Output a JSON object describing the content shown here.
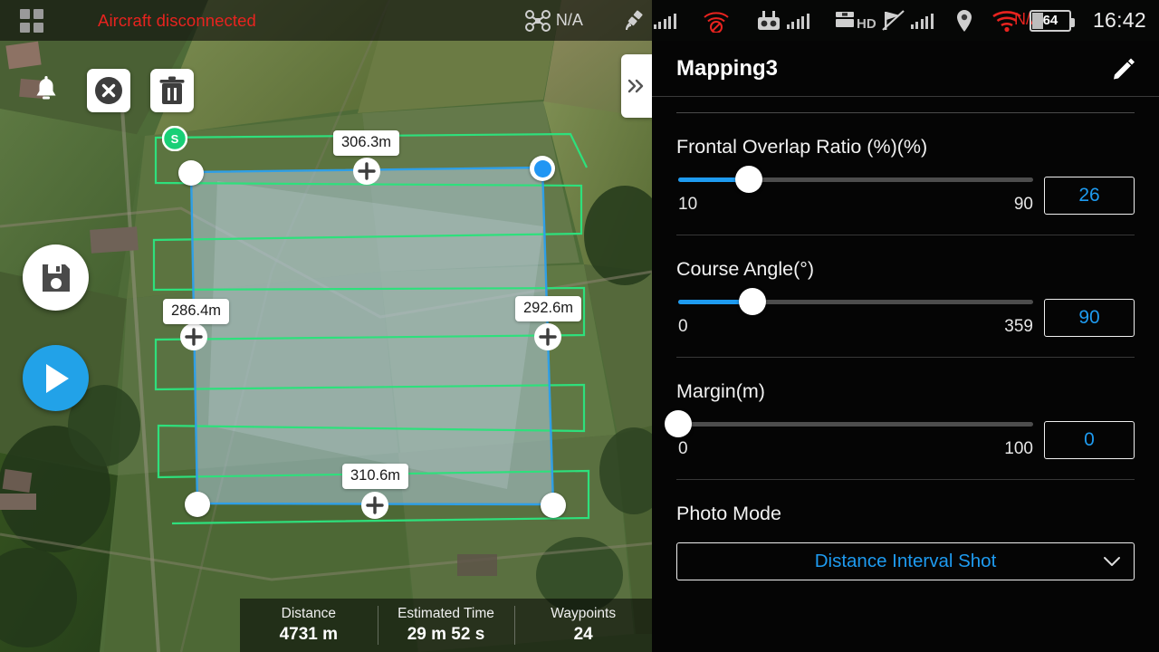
{
  "status_bar": {
    "app_grid_icon": "grid-icon",
    "alert_message": "Aircraft disconnected",
    "aircraft_icon": "drone-icon",
    "aircraft_status": "N/A",
    "satellite_icon": "satellite-icon",
    "rc_nosignal_icon": "no-signal-icon",
    "controller_icon": "remote-controller-icon",
    "hd_icon": "hd-video-icon",
    "signal_off_icon": "signal-off-icon",
    "location_icon": "location-pin-icon",
    "wifi_icon": "wifi-icon",
    "wifi_status": "N/A",
    "battery_percent": "64",
    "time": "16:42"
  },
  "map_controls": {
    "notification_icon": "bell-icon",
    "close_edit_icon": "close-circle-icon",
    "delete_icon": "trash-icon",
    "save_icon": "save-icon",
    "play_icon": "play-icon",
    "panel_toggle_icon": "chevron-double-right-icon",
    "start_marker": "S"
  },
  "map": {
    "distance_top": "306.3m",
    "distance_left": "286.4m",
    "distance_right": "292.6m",
    "distance_bottom": "310.6m",
    "colors": {
      "polygon_fill": "#a9c9dd",
      "polygon_edge": "#2f9fe6",
      "flight_path": "#24e07a",
      "start_marker": "#19cf76",
      "selected_vertex": "#2196f3"
    }
  },
  "stats": [
    {
      "label": "Distance",
      "value": "4731 m"
    },
    {
      "label": "Estimated Time",
      "value": "29 m 52 s"
    },
    {
      "label": "Waypoints",
      "value": "24"
    }
  ],
  "panel": {
    "title": "Mapping3",
    "edit_icon": "pencil-icon",
    "settings": [
      {
        "label": "Frontal Overlap Ratio (%)(%)",
        "value": "26",
        "min": "10",
        "max": "90",
        "fill_percent": 20
      },
      {
        "label": "Course Angle(°)",
        "value": "90",
        "min": "0",
        "max": "359",
        "fill_percent": 21
      },
      {
        "label": "Margin(m)",
        "value": "0",
        "min": "0",
        "max": "100",
        "fill_percent": 0
      }
    ],
    "photo_mode": {
      "label": "Photo Mode",
      "selected": "Distance Interval Shot",
      "chevron_icon": "chevron-down-icon"
    },
    "accent_color": "#1e9bf0"
  }
}
